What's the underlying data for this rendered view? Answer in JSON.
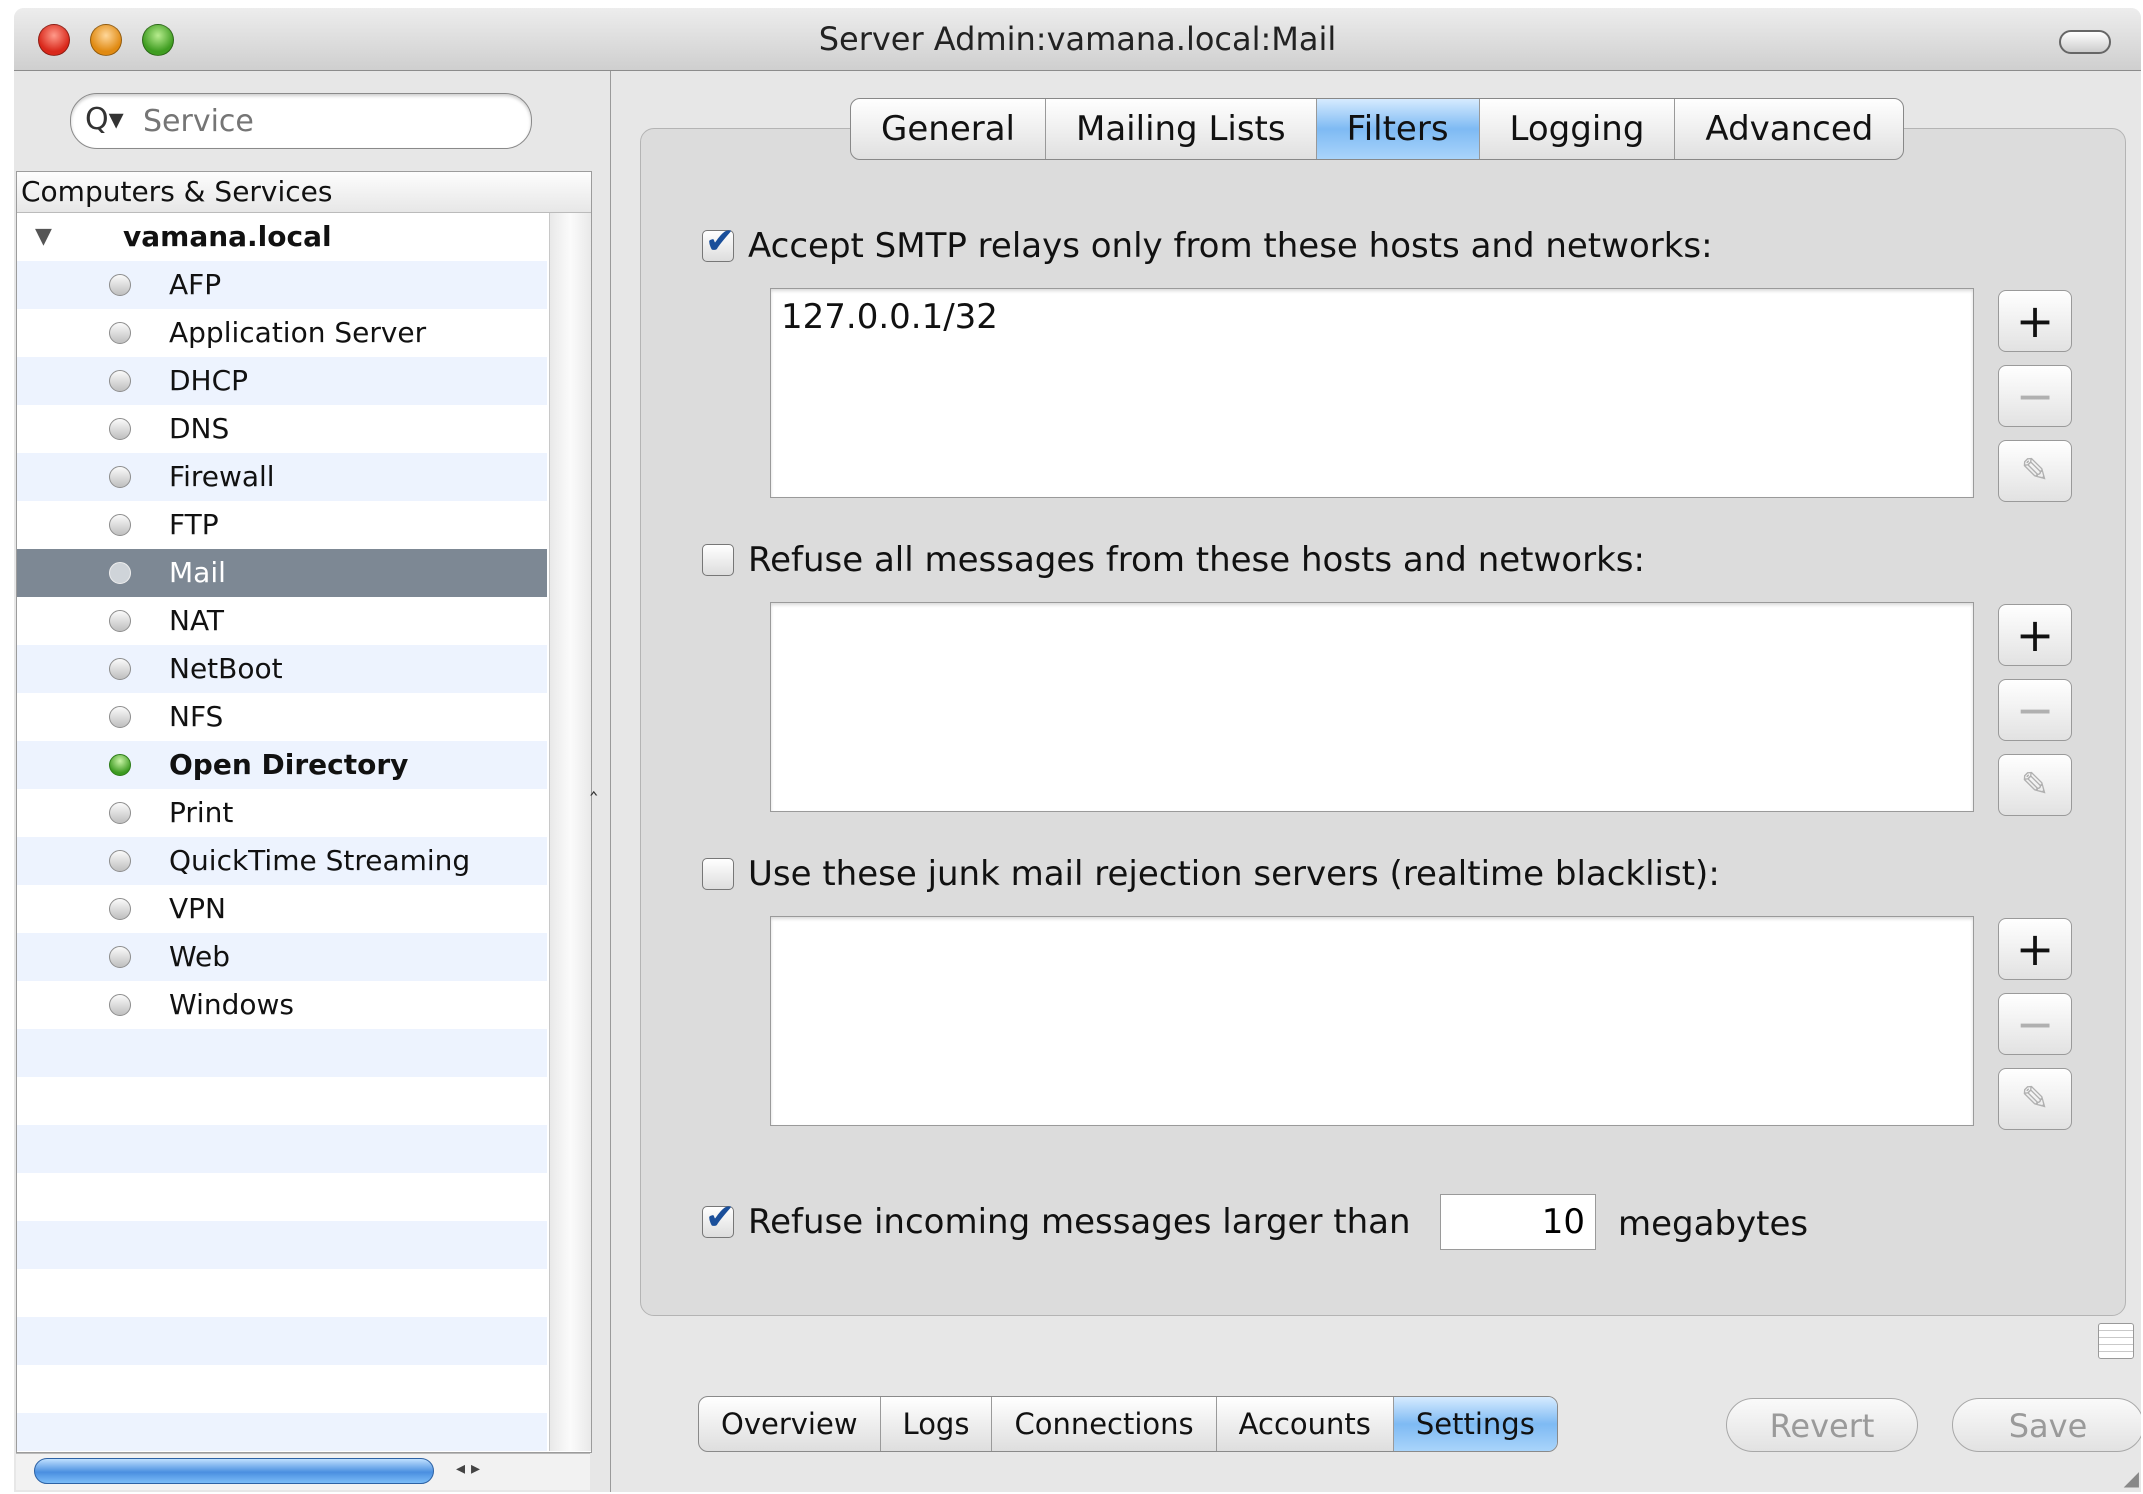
{
  "window": {
    "title": "Server Admin:vamana.local:Mail"
  },
  "sidebar": {
    "search_placeholder": "Service",
    "list_header": "Computers & Services",
    "host": "vamana.local",
    "services": [
      {
        "label": "AFP",
        "status": "off"
      },
      {
        "label": "Application Server",
        "status": "off"
      },
      {
        "label": "DHCP",
        "status": "off"
      },
      {
        "label": "DNS",
        "status": "off"
      },
      {
        "label": "Firewall",
        "status": "off"
      },
      {
        "label": "FTP",
        "status": "off"
      },
      {
        "label": "Mail",
        "status": "off",
        "selected": true
      },
      {
        "label": "NAT",
        "status": "off"
      },
      {
        "label": "NetBoot",
        "status": "off"
      },
      {
        "label": "NFS",
        "status": "off"
      },
      {
        "label": "Open Directory",
        "status": "running"
      },
      {
        "label": "Print",
        "status": "off"
      },
      {
        "label": "QuickTime Streaming",
        "status": "off"
      },
      {
        "label": "VPN",
        "status": "off"
      },
      {
        "label": "Web",
        "status": "off"
      },
      {
        "label": "Windows",
        "status": "off"
      }
    ]
  },
  "tabs": [
    "General",
    "Mailing Lists",
    "Filters",
    "Logging",
    "Advanced"
  ],
  "active_tab": "Filters",
  "filters": {
    "smtp_relay": {
      "label": "Accept SMTP relays only from these hosts and networks:",
      "checked": true,
      "entries": [
        "127.0.0.1/32"
      ]
    },
    "refuse_hosts": {
      "label": "Refuse all messages from these hosts and networks:",
      "checked": false,
      "entries": []
    },
    "rbl": {
      "label": "Use these junk mail rejection servers (realtime blacklist):",
      "checked": false,
      "entries": []
    },
    "size_limit": {
      "label": "Refuse incoming messages larger than",
      "checked": true,
      "value": "10",
      "unit": "megabytes"
    }
  },
  "bottom_tabs": [
    "Overview",
    "Logs",
    "Connections",
    "Accounts",
    "Settings"
  ],
  "active_bottom_tab": "Settings",
  "buttons": {
    "revert": "Revert",
    "save": "Save"
  },
  "icons": {
    "add": "+",
    "remove": "−",
    "edit": "✎",
    "search": "Q▾",
    "disclosure": "▼"
  },
  "colors": {
    "selection": "#7d8894",
    "active_tab": "#7ebaf3",
    "running_status": "#3c9a20"
  }
}
